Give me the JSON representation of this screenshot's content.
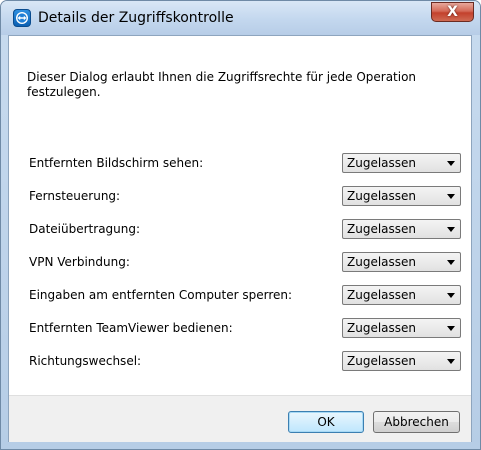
{
  "window": {
    "title": "Details der Zugriffskontrolle",
    "close_glyph": "X"
  },
  "description": "Dieser Dialog erlaubt Ihnen die Zugriffsrechte für jede Operation festzulegen.",
  "rows": [
    {
      "label": "Entfernten Bildschirm sehen:",
      "value": "Zugelassen"
    },
    {
      "label": "Fernsteuerung:",
      "value": "Zugelassen"
    },
    {
      "label": "Dateiübertragung:",
      "value": "Zugelassen"
    },
    {
      "label": "VPN Verbindung:",
      "value": "Zugelassen"
    },
    {
      "label": "Eingaben am entfernten Computer sperren:",
      "value": "Zugelassen"
    },
    {
      "label": "Entfernten TeamViewer bedienen:",
      "value": "Zugelassen"
    },
    {
      "label": "Richtungswechsel:",
      "value": "Zugelassen"
    }
  ],
  "buttons": {
    "ok": "OK",
    "cancel": "Abbrechen"
  }
}
